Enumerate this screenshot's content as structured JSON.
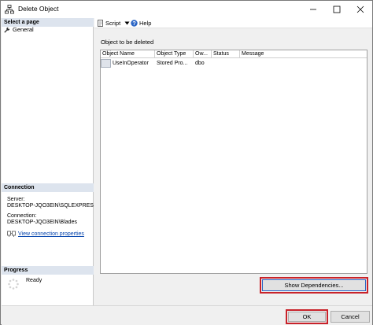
{
  "window": {
    "title": "Delete Object",
    "controls": [
      "minimize",
      "maximize",
      "close"
    ]
  },
  "left_pane": {
    "select_page_header": "Select a page",
    "pages": [
      {
        "label": "General",
        "icon": "wrench-icon"
      }
    ],
    "connection_header": "Connection",
    "server_label": "Server:",
    "server_value": "DESKTOP-JQO3EIN\\SQLEXPRES",
    "connection_label": "Connection:",
    "connection_value": "DESKTOP-JQO3EIN\\Blades",
    "view_properties_link": "View connection properties",
    "progress_header": "Progress",
    "progress_status": "Ready"
  },
  "toolbar": {
    "script_label": "Script",
    "help_label": "Help"
  },
  "main": {
    "objects_label": "Object to be deleted",
    "columns": [
      "Object Name",
      "Object Type",
      "Ow...",
      "Status",
      "Message"
    ],
    "rows": [
      {
        "object_name": "UseInOperator",
        "object_type": "Stored Pro...",
        "owner": "dbo",
        "status": "",
        "message": ""
      }
    ],
    "show_dependencies_label": "Show Dependencies..."
  },
  "footer": {
    "ok_label": "OK",
    "cancel_label": "Cancel"
  },
  "colors": {
    "section_header_bg": "#dde4ee",
    "highlight_red": "#c8222a",
    "focus_blue": "#2b65c5",
    "link_blue": "#0645ad"
  }
}
